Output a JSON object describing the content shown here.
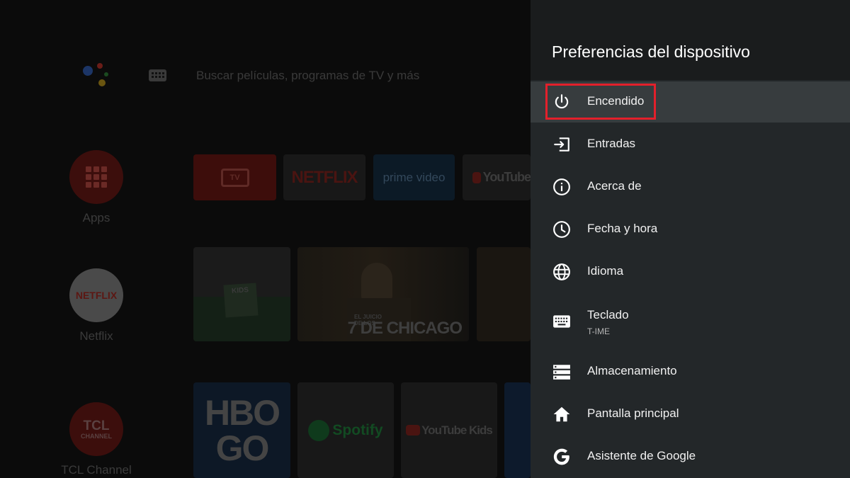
{
  "home": {
    "search_placeholder": "Buscar películas, programas de TV y más",
    "side_apps": [
      {
        "label": "Apps"
      },
      {
        "label": "Netflix",
        "logo": "NETFLIX"
      },
      {
        "label": "TCL Channel",
        "logo_top": "TCL",
        "logo_bottom": "CHANNEL"
      }
    ],
    "favorite_tiles": [
      "TV",
      "NETFLIX",
      "prime video",
      "YouTube"
    ],
    "content_tiles": [
      "KIDS",
      "7 DE CHICAGO",
      "EL JUICIO DE LOS"
    ],
    "bottom_tiles": [
      "HBO",
      "GO",
      "Spotify",
      "YouTube Kids"
    ]
  },
  "panel": {
    "title": "Preferencias del dispositivo",
    "items": [
      {
        "label": "Encendido",
        "icon": "power-icon",
        "selected": true
      },
      {
        "label": "Entradas",
        "icon": "input-icon"
      },
      {
        "label": "Acerca de",
        "icon": "info-icon"
      },
      {
        "label": "Fecha y hora",
        "icon": "clock-icon"
      },
      {
        "label": "Idioma",
        "icon": "globe-icon"
      },
      {
        "label": "Teclado",
        "sub": "T-IME",
        "icon": "keyboard-icon"
      },
      {
        "label": "Almacenamiento",
        "icon": "storage-icon"
      },
      {
        "label": "Pantalla principal",
        "icon": "home-icon"
      },
      {
        "label": "Asistente de Google",
        "icon": "google-icon"
      }
    ]
  },
  "colors": {
    "panel_bg": "#232729",
    "header_bg": "#1a1c1d",
    "selected_bg": "#373c3e",
    "highlight": "#e3202b"
  }
}
